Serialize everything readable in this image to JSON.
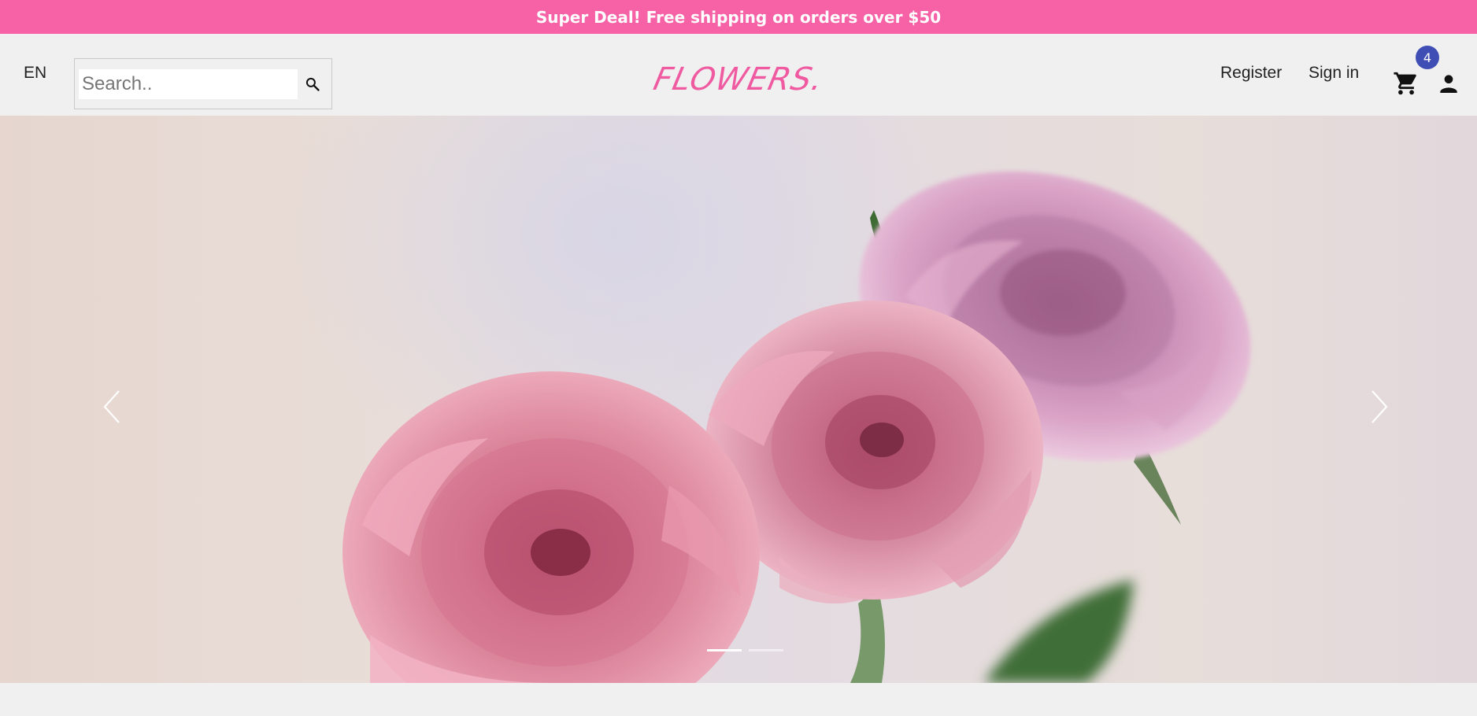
{
  "announcement": {
    "text": "Super Deal! Free shipping on orders over $50"
  },
  "header": {
    "language": "EN",
    "search": {
      "placeholder": "Search..",
      "value": ""
    },
    "logo": "FLOWERS.",
    "register": "Register",
    "signin": "Sign in",
    "cart_count": "4"
  },
  "icons": {
    "search": "search-icon",
    "cart": "shopping-cart-icon",
    "user": "user-icon",
    "prev": "chevron-left-icon",
    "next": "chevron-right-icon"
  },
  "carousel": {
    "slide_count": 2,
    "active_slide": 1,
    "image": "pink roses"
  },
  "colors": {
    "announcement_bg": "#f762a6",
    "logo": "#ef5aa1",
    "badge": "#3f4eb5",
    "page_bg": "#f0f0f0"
  }
}
